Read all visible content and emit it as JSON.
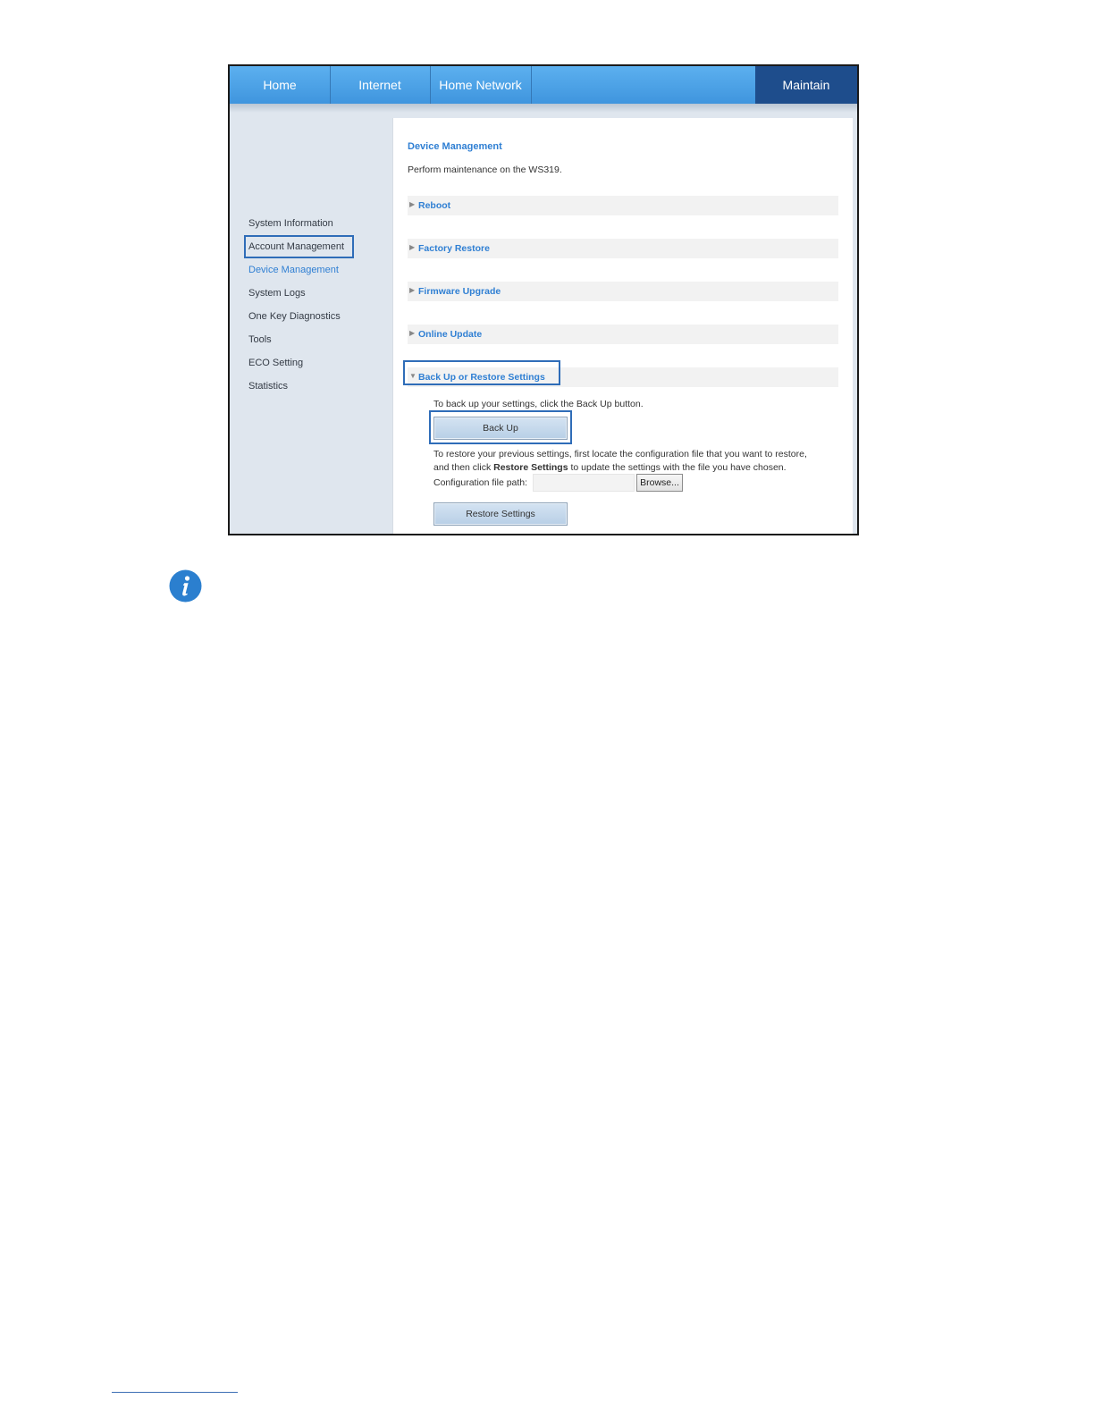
{
  "nav": {
    "tabs": [
      "Home",
      "Internet",
      "Home Network"
    ],
    "active_tab": "Maintain"
  },
  "sidebar": {
    "items": [
      "System Information",
      "Account Management",
      "Device Management",
      "System Logs",
      "One Key Diagnostics",
      "Tools",
      "ECO Setting",
      "Statistics"
    ],
    "active_index": 2
  },
  "content": {
    "title": "Device Management",
    "description": "Perform maintenance on the WS319.",
    "sections": [
      "Reboot",
      "Factory Restore",
      "Firmware Upgrade",
      "Online Update",
      "Back Up or Restore Settings"
    ],
    "expanded_index": 4,
    "backup": {
      "instruction": "To back up your settings, click the Back Up button.",
      "button_label": "Back Up"
    },
    "restore": {
      "instruction_line1": "To restore your previous settings, first locate the configuration file that you want to restore,",
      "instruction_line2_prefix": "and then click ",
      "instruction_line2_bold": "Restore Settings",
      "instruction_line2_suffix": " to update the settings with the file you have chosen.",
      "file_path_label": "Configuration file path:",
      "file_path_value": "",
      "browse_label": "Browse...",
      "button_label": "Restore Settings"
    }
  },
  "colors": {
    "nav_blue": "#4aa3e8",
    "active_tab": "#1e4d8c",
    "link_blue": "#2f7fd3",
    "highlight_box": "#2f6db8",
    "info_icon": "#2b7fcf"
  },
  "icons": {
    "info": "info-icon"
  }
}
